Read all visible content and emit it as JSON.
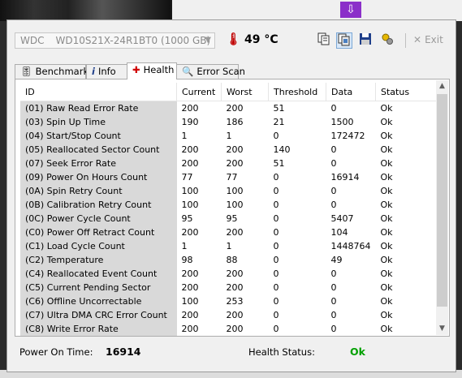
{
  "toolbar": {
    "drive_brand": "WDC",
    "drive_model": "WD10S21X-24R1BT0 (1000 GB)",
    "temperature": "49 °C",
    "exit_label": "Exit"
  },
  "tabs": [
    {
      "label": "Benchmark",
      "icon": "benchmark-icon"
    },
    {
      "label": "Info",
      "icon": "info-icon"
    },
    {
      "label": "Health",
      "icon": "health-cross-icon"
    },
    {
      "label": "Error Scan",
      "icon": "magnifier-icon"
    }
  ],
  "table": {
    "columns": [
      "ID",
      "Current",
      "Worst",
      "Threshold",
      "Data",
      "Status"
    ],
    "rows": [
      [
        "(01) Raw Read Error Rate",
        "200",
        "200",
        "51",
        "0",
        "Ok"
      ],
      [
        "(03) Spin Up Time",
        "190",
        "186",
        "21",
        "1500",
        "Ok"
      ],
      [
        "(04) Start/Stop Count",
        "1",
        "1",
        "0",
        "172472",
        "Ok"
      ],
      [
        "(05) Reallocated Sector Count",
        "200",
        "200",
        "140",
        "0",
        "Ok"
      ],
      [
        "(07) Seek Error Rate",
        "200",
        "200",
        "51",
        "0",
        "Ok"
      ],
      [
        "(09) Power On Hours Count",
        "77",
        "77",
        "0",
        "16914",
        "Ok"
      ],
      [
        "(0A) Spin Retry Count",
        "100",
        "100",
        "0",
        "0",
        "Ok"
      ],
      [
        "(0B) Calibration Retry Count",
        "100",
        "100",
        "0",
        "0",
        "Ok"
      ],
      [
        "(0C) Power Cycle Count",
        "95",
        "95",
        "0",
        "5407",
        "Ok"
      ],
      [
        "(C0) Power Off Retract Count",
        "200",
        "200",
        "0",
        "104",
        "Ok"
      ],
      [
        "(C1) Load Cycle Count",
        "1",
        "1",
        "0",
        "1448764",
        "Ok"
      ],
      [
        "(C2) Temperature",
        "98",
        "88",
        "0",
        "49",
        "Ok"
      ],
      [
        "(C4) Reallocated Event Count",
        "200",
        "200",
        "0",
        "0",
        "Ok"
      ],
      [
        "(C5) Current Pending Sector",
        "200",
        "200",
        "0",
        "0",
        "Ok"
      ],
      [
        "(C6) Offline Uncorrectable",
        "100",
        "253",
        "0",
        "0",
        "Ok"
      ],
      [
        "(C7) Ultra DMA CRC Error Count",
        "200",
        "200",
        "0",
        "0",
        "Ok"
      ],
      [
        "(C8) Write Error Rate",
        "200",
        "200",
        "0",
        "0",
        "Ok"
      ]
    ]
  },
  "status": {
    "power_on_label": "Power On Time:",
    "power_on_value": "16914",
    "health_label": "Health Status:",
    "health_value": "Ok"
  },
  "colors": {
    "health_ok": "#00a000",
    "temp_icon": "#c00000"
  }
}
